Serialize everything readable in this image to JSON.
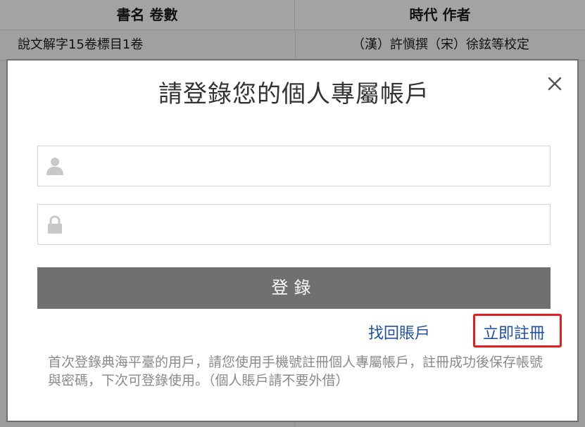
{
  "background_table": {
    "headers": [
      "書名 卷數",
      "時代 作者"
    ],
    "rows": [
      {
        "title": "說文解字15卷標目1卷",
        "author": "（漢）許愼撰（宋）徐鉉等校定"
      }
    ]
  },
  "modal": {
    "title": "請登錄您的個人專屬帳戶",
    "username": {
      "value": "",
      "placeholder": ""
    },
    "password": {
      "value": "",
      "placeholder": ""
    },
    "login_label": "登錄",
    "recover_label": "找回賬戶",
    "register_label": "立即註冊",
    "notice": "首次登錄典海平臺的用戶，請您使用手機號註冊個人專屬帳戶，註冊成功後保存帳號與密碼，下次可登錄使用。（個人賬戶請不要外借）"
  },
  "colors": {
    "login_button": "#707070",
    "link": "#1f4fa8",
    "highlight_box": "#e02020",
    "overlay": "#9c9c9c"
  },
  "icons": [
    "user-icon",
    "lock-icon",
    "close-icon"
  ]
}
